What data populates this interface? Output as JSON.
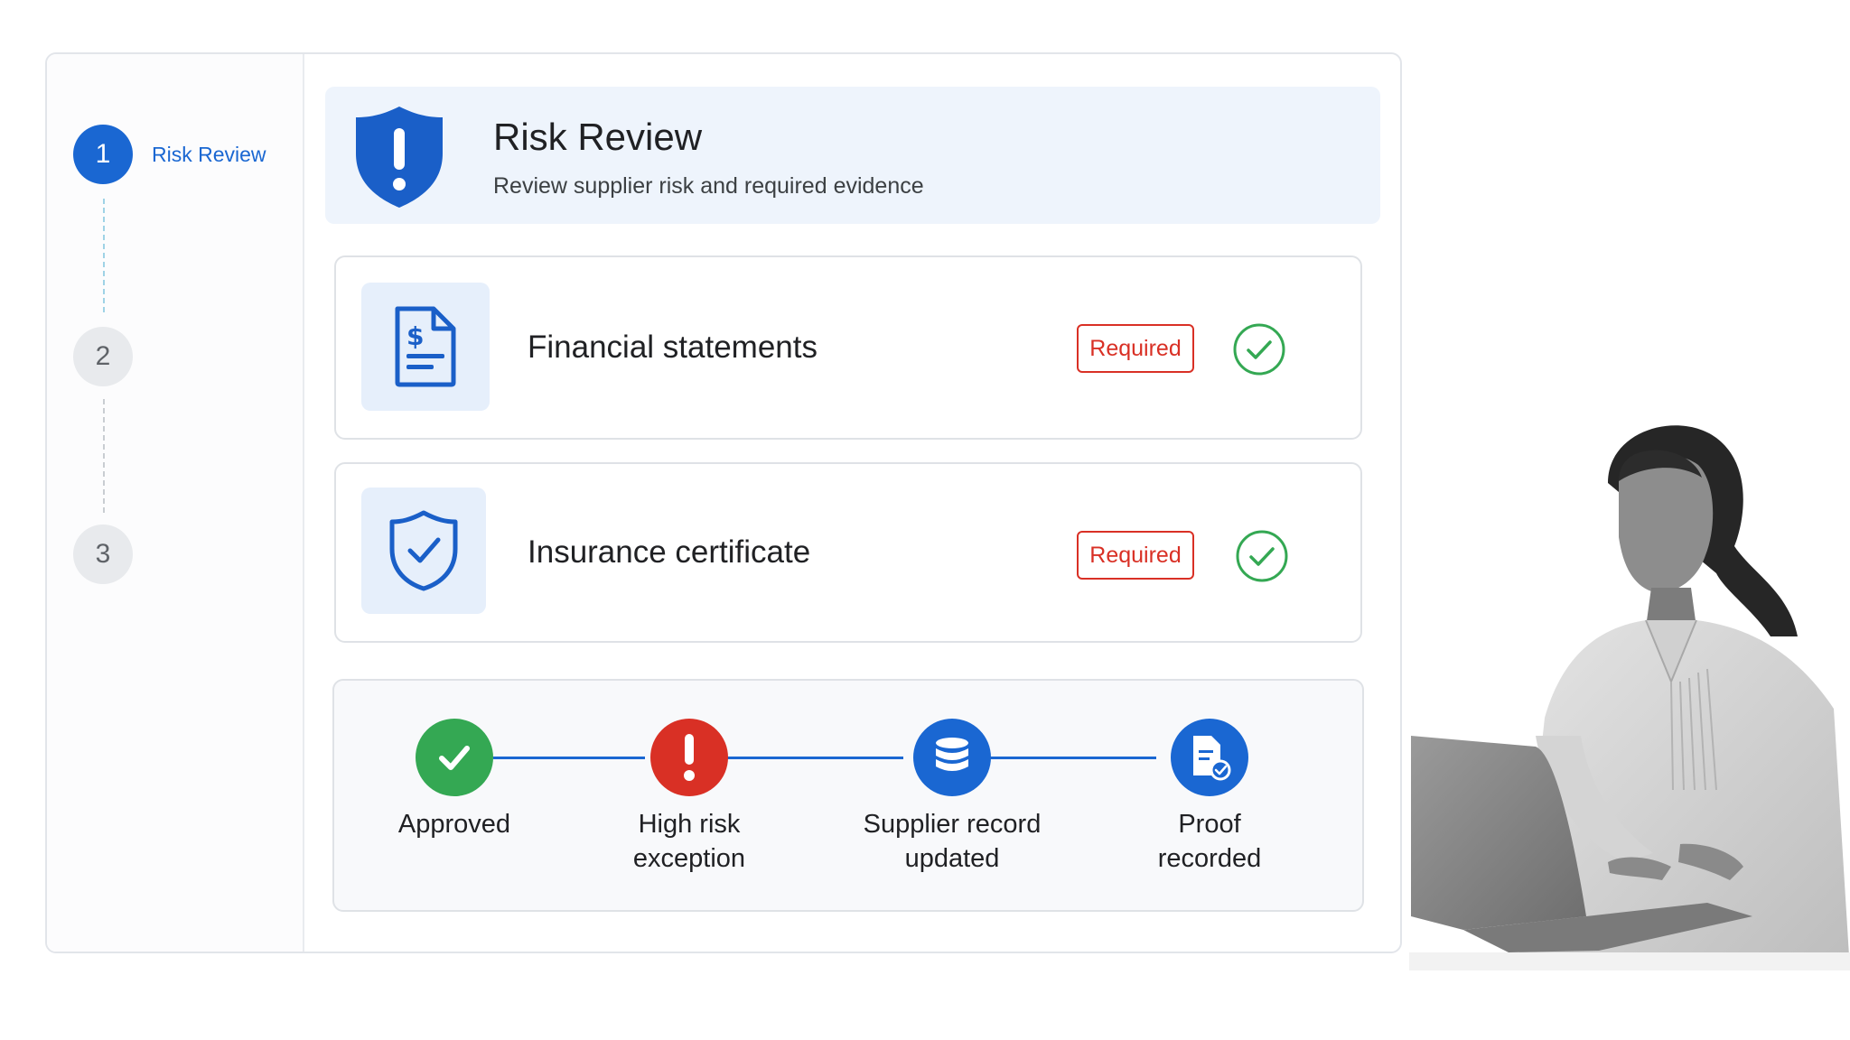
{
  "sidebar": {
    "steps": [
      {
        "number": "1",
        "label": "Risk Review",
        "state": "active"
      },
      {
        "number": "2",
        "label": "",
        "state": "inactive"
      },
      {
        "number": "3",
        "label": "",
        "state": "inactive"
      }
    ]
  },
  "header": {
    "icon": "shield-exclamation-icon",
    "title": "Risk Review",
    "subtitle": "Review supplier risk and required evidence"
  },
  "evidence": [
    {
      "icon": "financial-document-icon",
      "label": "Financial statements",
      "badge": "Required",
      "status_icon": "check-circle-icon"
    },
    {
      "icon": "shield-check-icon",
      "label": "Insurance certificate",
      "badge": "Required",
      "status_icon": "check-circle-icon"
    }
  ],
  "timeline": [
    {
      "icon": "check-icon",
      "label": "Approved",
      "color": "#34a853"
    },
    {
      "icon": "exclamation-icon",
      "label": "High risk exception",
      "color": "#d93025"
    },
    {
      "icon": "database-icon",
      "label": "Supplier record updated",
      "color": "#1a67d2"
    },
    {
      "icon": "document-check-icon",
      "label": "Proof recorded",
      "color": "#1a67d2"
    }
  ],
  "colors": {
    "accent": "#1a67d2",
    "required": "#d93025",
    "success": "#34a853"
  }
}
